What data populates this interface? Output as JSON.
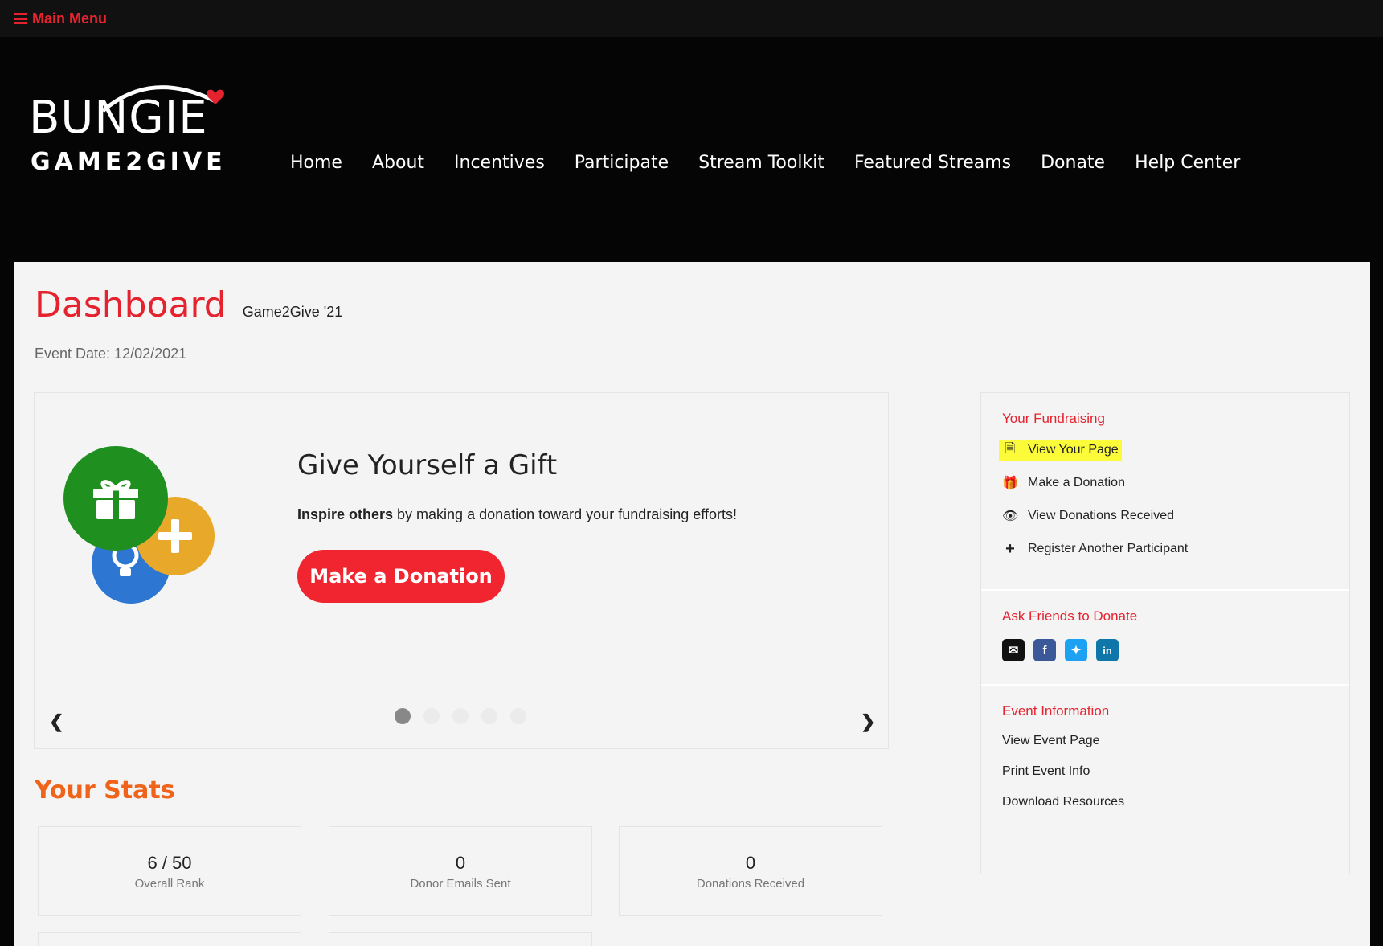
{
  "topbar": {
    "main_menu": "Main Menu"
  },
  "logo": {
    "line1": "BUNGIE",
    "line2": "GAME2GIVE"
  },
  "nav": [
    "Home",
    "About",
    "Incentives",
    "Participate",
    "Stream Toolkit",
    "Featured Streams",
    "Donate",
    "Help Center"
  ],
  "dashboard": {
    "title": "Dashboard",
    "event_name": "Game2Give '21",
    "event_date": "Event Date: 12/02/2021"
  },
  "slide": {
    "title": "Give Yourself a Gift",
    "text_bold": "Inspire others",
    "text_rest": " by making a donation toward your fundraising efforts!",
    "button": "Make a Donation",
    "active_dot": 1,
    "dot_count": 5
  },
  "stats": {
    "title": "Your Stats",
    "cards": [
      {
        "value": "6 / 50",
        "label": "Overall Rank"
      },
      {
        "value": "0",
        "label": "Donor Emails Sent"
      },
      {
        "value": "0",
        "label": "Donations Received"
      }
    ]
  },
  "sidebar": {
    "fundraising_head": "Your Fundraising",
    "fundraising_links": [
      {
        "label": "View Your Page",
        "icon": "file-icon"
      },
      {
        "label": "Make a Donation",
        "icon": "gift-icon"
      },
      {
        "label": "View Donations Received",
        "icon": "eye-icon"
      },
      {
        "label": "Register Another Participant",
        "icon": "plus-icon"
      }
    ],
    "ask_head": "Ask Friends to Donate",
    "share": [
      {
        "name": "email",
        "color": "#111111"
      },
      {
        "name": "facebook",
        "color": "#3b5998"
      },
      {
        "name": "twitter",
        "color": "#1da1f2"
      },
      {
        "name": "linkedin",
        "color": "#0e76a8"
      }
    ],
    "event_head": "Event Information",
    "event_links": [
      "View Event Page",
      "Print Event Info",
      "Download Resources"
    ]
  },
  "colors": {
    "accent": "#e5232f",
    "stats_orange": "#f0631a",
    "highlight": "#fbfb3a"
  }
}
